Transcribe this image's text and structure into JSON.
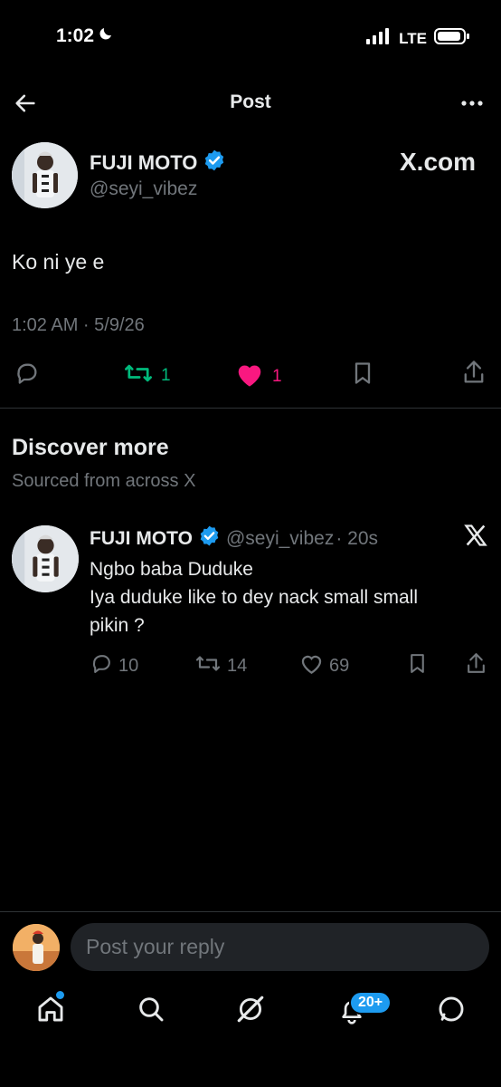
{
  "status_bar": {
    "time": "1:02",
    "network": "LTE"
  },
  "header": {
    "title": "Post"
  },
  "post": {
    "author_name": "FUJI MOTO",
    "author_handle": "@seyi_vibez",
    "source_label": "X.com",
    "text": "Ko ni ye e",
    "timestamp": "1:02 AM · 5/9/26",
    "repost_count": "1",
    "like_count": "1"
  },
  "discover": {
    "title": "Discover more",
    "subtitle": "Sourced from across X",
    "items": [
      {
        "author_name": "FUJI MOTO",
        "author_handle": "@seyi_vibez",
        "time": "· 20s",
        "text_line1": "Ngbo baba Duduke",
        "text_line2": "Iya duduke like to dey nack small small",
        "text_line3": "pikin ?",
        "reply_count": "10",
        "repost_count": "14",
        "like_count": "69"
      }
    ]
  },
  "reply_bar": {
    "placeholder": "Post your reply"
  },
  "bottom_nav": {
    "notification_badge": "20+"
  },
  "colors": {
    "accent": "#1d9bf0",
    "repost": "#00ba7c",
    "like": "#f91880",
    "muted": "#71767b"
  }
}
